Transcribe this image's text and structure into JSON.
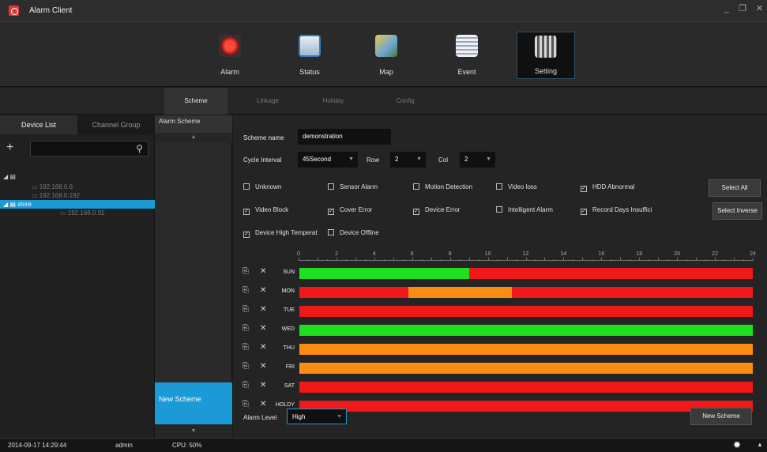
{
  "window": {
    "title": "Alarm Client",
    "minimize": "_",
    "restore": "❐",
    "close": "✕"
  },
  "toolbar": [
    {
      "label": "Alarm",
      "icon": "alarm-icon",
      "color": "#c0392b"
    },
    {
      "label": "Status",
      "icon": "status-icon",
      "color": "#3a7bbf"
    },
    {
      "label": "Map",
      "icon": "map-icon",
      "color": "#6aa6d6"
    },
    {
      "label": "Event",
      "icon": "event-icon",
      "color": "#9aa8c4"
    },
    {
      "label": "Setting",
      "icon": "setting-icon",
      "color": "#d6d6d6",
      "active": true
    }
  ],
  "subtabs": [
    "Scheme",
    "Linkage",
    "Holiday",
    "Config"
  ],
  "left": {
    "tabs": [
      "Device List",
      "Channel Group"
    ],
    "add": "+",
    "search_icon": "⚲",
    "tree": [
      {
        "label": "",
        "level": 0,
        "folder": true
      },
      {
        "label": "192.168.0.6",
        "level": 1
      },
      {
        "label": "192.168.0.192",
        "level": 1
      },
      {
        "label": "store",
        "level": 0,
        "folder": true,
        "selected": true
      },
      {
        "label": "192.168.0.92",
        "level": 2
      }
    ]
  },
  "mid": {
    "header": "Alarm Scheme",
    "up": "▲",
    "new_scheme": "New Scheme",
    "down": "▼"
  },
  "form": {
    "scheme_label": "Scheme name",
    "scheme_value": "demonstration",
    "cycle_label": "Cycle Interval",
    "cycle_value": "45Second",
    "row_label": "Row",
    "row_value": "2",
    "col_label": "Col",
    "col_value": "2",
    "alarm_level_label": "Alarm Level",
    "alarm_level_value": "High",
    "caret": "▼"
  },
  "checkboxes": [
    {
      "label": "Unknown",
      "checked": false
    },
    {
      "label": "Sensor Alarm",
      "checked": false
    },
    {
      "label": "Motion Detection",
      "checked": false
    },
    {
      "label": "Video loss",
      "checked": false
    },
    {
      "label": "HDD Abnormal",
      "checked": true
    },
    {
      "label": "Video Block",
      "checked": true
    },
    {
      "label": "Cover Error",
      "checked": true
    },
    {
      "label": "Device Error",
      "checked": true
    },
    {
      "label": "Intelligent Alarm",
      "checked": false
    },
    {
      "label": "Record Days Insuffici",
      "checked": true
    },
    {
      "label": "Device High Temperat",
      "checked": true
    },
    {
      "label": "Device Offline",
      "checked": false
    }
  ],
  "buttons": {
    "select_all": "Select All",
    "select_inverse": "Select Inverse",
    "new_scheme": "New Scheme"
  },
  "ruler": [
    "0",
    "2",
    "4",
    "6",
    "8",
    "10",
    "12",
    "14",
    "16",
    "18",
    "20",
    "22",
    "24"
  ],
  "colors": {
    "green": "#1fe01f",
    "red": "#f01818",
    "orange": "#fa8c14",
    "accent": "#1b9ad6"
  },
  "schedule": [
    {
      "day": "SUN",
      "segments": [
        {
          "from": 0,
          "to": 9,
          "color": "green"
        },
        {
          "from": 9,
          "to": 24,
          "color": "red"
        }
      ]
    },
    {
      "day": "MON",
      "segments": [
        {
          "from": 0,
          "to": 5.75,
          "color": "red"
        },
        {
          "from": 5.75,
          "to": 11.25,
          "color": "orange"
        },
        {
          "from": 11.25,
          "to": 24,
          "color": "red"
        }
      ]
    },
    {
      "day": "TUE",
      "segments": [
        {
          "from": 0,
          "to": 24,
          "color": "red"
        }
      ]
    },
    {
      "day": "WED",
      "segments": [
        {
          "from": 0,
          "to": 24,
          "color": "green"
        }
      ]
    },
    {
      "day": "THU",
      "segments": [
        {
          "from": 0,
          "to": 24,
          "color": "orange"
        }
      ]
    },
    {
      "day": "FRI",
      "segments": [
        {
          "from": 0,
          "to": 24,
          "color": "orange"
        }
      ]
    },
    {
      "day": "SAT",
      "segments": [
        {
          "from": 0,
          "to": 24,
          "color": "red"
        }
      ]
    },
    {
      "day": "HOLDY",
      "segments": [
        {
          "from": 0,
          "to": 24,
          "color": "red"
        }
      ]
    }
  ],
  "row_icons": {
    "copy": "⎘",
    "delete": "✕"
  },
  "status": {
    "datetime": "2014-09-17 14:29:44",
    "user": "admin",
    "cpu": "CPU: 50%",
    "alarm_icon": "✹",
    "arrow": "▲"
  }
}
